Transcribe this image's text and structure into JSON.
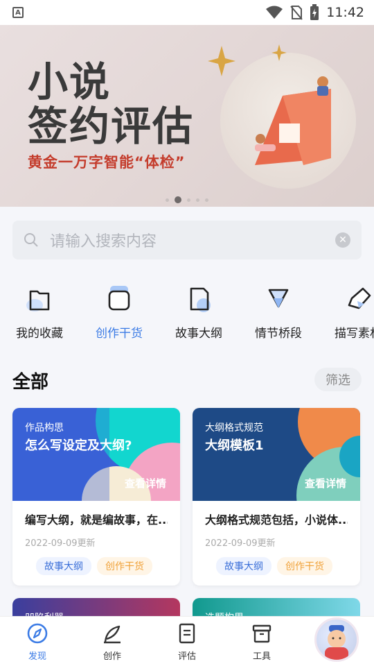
{
  "status_bar": {
    "time": "11:42",
    "left_icon": "A"
  },
  "banner": {
    "title_line1": "小说",
    "title_line2": "签约评估",
    "subtitle": "黄金一万字智能“体检”",
    "pager_count": 5,
    "pager_active": 1
  },
  "search": {
    "placeholder": "请输入搜索内容"
  },
  "categories": [
    {
      "label": "我的收藏",
      "icon": "folder-icon"
    },
    {
      "label": "创作干货",
      "icon": "window-icon"
    },
    {
      "label": "故事大纲",
      "icon": "note-icon"
    },
    {
      "label": "情节桥段",
      "icon": "triangle-icon"
    },
    {
      "label": "描写素材",
      "icon": "tag-icon"
    }
  ],
  "section": {
    "title": "全部",
    "filter_label": "筛选"
  },
  "cards": [
    {
      "kicker": "作品构思",
      "headline": "怎么写设定及大纲?",
      "detail": "查看详情",
      "desc": "编写大纲，就是编故事，在...",
      "date": "2022-09-09更新",
      "tags": [
        "故事大纲",
        "创作干货"
      ]
    },
    {
      "kicker": "大纲格式规范",
      "headline": "大纲模板1",
      "detail": "查看详情",
      "desc": "大纲格式规范包括，小说体...",
      "date": "2022-09-09更新",
      "tags": [
        "故事大纲",
        "创作干货"
      ]
    }
  ],
  "peek_cards": [
    {
      "kicker": "凹陷利器"
    },
    {
      "kicker": "选题构思"
    }
  ],
  "colors": {
    "accent": "#3b7be5",
    "tag_blue": "#3b6fd8",
    "tag_orange": "#f0a23a"
  },
  "nav": [
    {
      "label": "发现",
      "icon": "compass-icon",
      "active": true
    },
    {
      "label": "创作",
      "icon": "feather-icon",
      "active": false
    },
    {
      "label": "评估",
      "icon": "document-icon",
      "active": false
    },
    {
      "label": "工具",
      "icon": "toolbox-icon",
      "active": false
    }
  ]
}
